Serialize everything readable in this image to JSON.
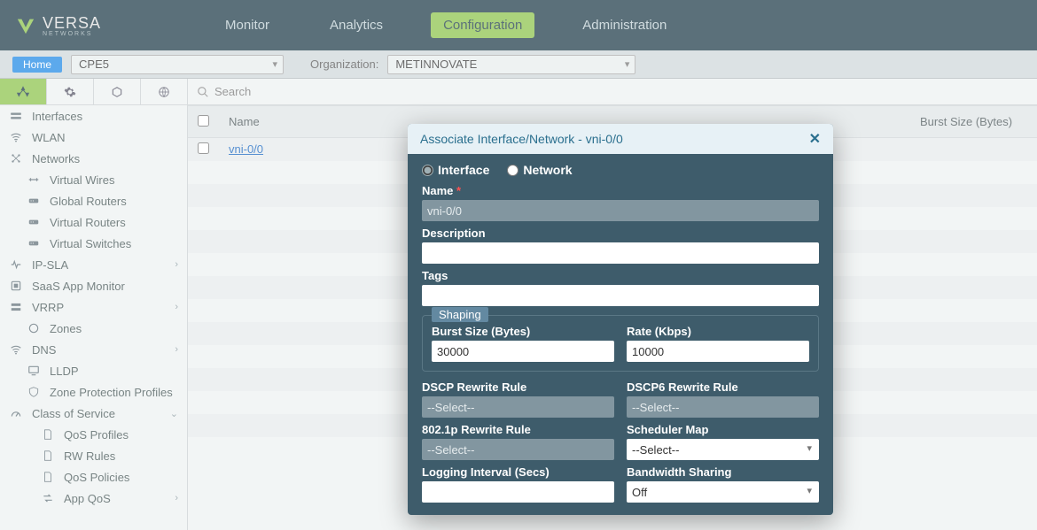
{
  "brand": {
    "name": "VERSA",
    "sub": "NETWORKS"
  },
  "mainnav": {
    "items": [
      "Monitor",
      "Analytics",
      "Configuration",
      "Administration"
    ],
    "active_index": 2
  },
  "contextbar": {
    "home_label": "Home",
    "device": "CPE5",
    "org_label": "Organization:",
    "org": "METINNOVATE"
  },
  "search": {
    "placeholder": "Search"
  },
  "sidebar": {
    "items": [
      {
        "label": "Interfaces",
        "icon": "interfaces"
      },
      {
        "label": "WLAN",
        "icon": "wifi"
      },
      {
        "label": "Networks",
        "icon": "net"
      },
      {
        "label": "Virtual Wires",
        "icon": "wire",
        "indent": true
      },
      {
        "label": "Global Routers",
        "icon": "router",
        "indent": true
      },
      {
        "label": "Virtual Routers",
        "icon": "router",
        "indent": true
      },
      {
        "label": "Virtual Switches",
        "icon": "router",
        "indent": true
      },
      {
        "label": "IP-SLA",
        "icon": "pulse",
        "expand": true
      },
      {
        "label": "SaaS App Monitor",
        "icon": "app"
      },
      {
        "label": "VRRP",
        "icon": "vrrp",
        "expand": true
      },
      {
        "label": "Zones",
        "icon": "zone",
        "indent": true
      },
      {
        "label": "DNS",
        "icon": "wifi",
        "expand": true
      },
      {
        "label": "LLDP",
        "icon": "screen",
        "indent": true
      },
      {
        "label": "Zone Protection Profiles",
        "icon": "shield",
        "indent": true
      },
      {
        "label": "Class of Service",
        "icon": "gauge",
        "expand": true,
        "open": true
      },
      {
        "label": "QoS Profiles",
        "icon": "doc",
        "indent": true,
        "deep": true
      },
      {
        "label": "RW Rules",
        "icon": "doc",
        "indent": true,
        "deep": true
      },
      {
        "label": "QoS Policies",
        "icon": "doc",
        "indent": true,
        "deep": true
      },
      {
        "label": "App QoS",
        "icon": "arrows",
        "indent": true,
        "deep": true,
        "expand": true
      }
    ]
  },
  "table": {
    "col_name": "Name",
    "col_burst": "Burst Size (Bytes)",
    "rows": [
      "vni-0/0"
    ]
  },
  "modal": {
    "title": "Associate Interface/Network - vni-0/0",
    "radio_interface": "Interface",
    "radio_network": "Network",
    "name_label": "Name",
    "name_value": "vni-0/0",
    "desc_label": "Description",
    "desc_value": "",
    "tags_label": "Tags",
    "tags_value": "",
    "shaping_legend": "Shaping",
    "burst_label": "Burst Size (Bytes)",
    "burst_value": "30000",
    "rate_label": "Rate (Kbps)",
    "rate_value": "10000",
    "dscp_label": "DSCP Rewrite Rule",
    "dscp_value": "--Select--",
    "dscp6_label": "DSCP6 Rewrite Rule",
    "dscp6_value": "--Select--",
    "p8021_label": "802.1p Rewrite Rule",
    "p8021_value": "--Select--",
    "sched_label": "Scheduler Map",
    "sched_value": "--Select--",
    "loginterval_label": "Logging Interval (Secs)",
    "loginterval_value": "",
    "bw_label": "Bandwidth Sharing",
    "bw_value": "Off"
  }
}
